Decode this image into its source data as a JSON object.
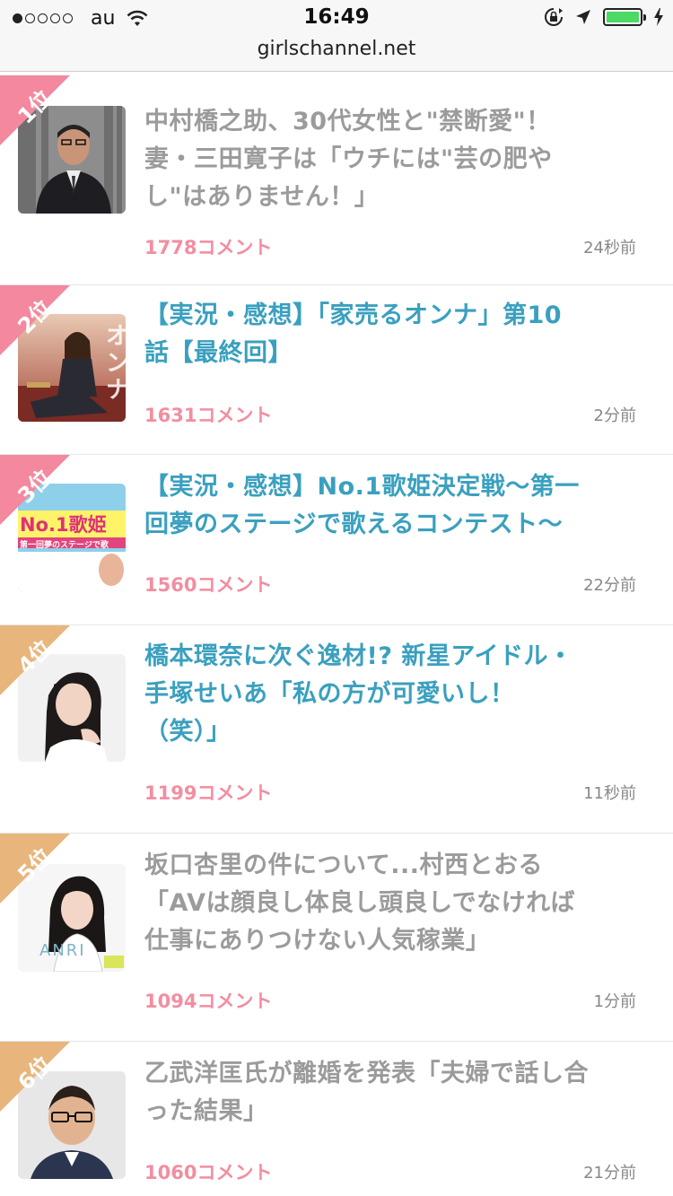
{
  "status_bar": {
    "carrier": "au",
    "time": "16:49",
    "url": "girlschannel.net",
    "signal_dots_filled": 1,
    "battery_level": 1.0
  },
  "colors": {
    "rank_pink": "#f4889e",
    "rank_gold": "#e8b67c",
    "comment_pink": "#f28ea0",
    "title_blue": "#3aa0bf",
    "title_gray": "#9b9b9b"
  },
  "ranking": [
    {
      "rank": "1位",
      "title": "中村橋之助、30代女性と\"禁断愛\"！\n妻・三田寛子は「ウチには\"芸の肥や\nし\"はありません！」",
      "comments": "1778コメント",
      "ago": "24秒前"
    },
    {
      "rank": "2位",
      "title": "【実況・感想】「家売るオンナ」第10\n話【最終回】",
      "comments": "1631コメント",
      "ago": "2分前"
    },
    {
      "rank": "3位",
      "title": "【実況・感想】No.1歌姫決定戦～第一\n回夢のステージで歌えるコンテスト～",
      "comments": "1560コメント",
      "ago": "22分前"
    },
    {
      "rank": "4位",
      "title": "橋本環奈に次ぐ逸材!? 新星アイドル・\n手塚せいあ「私の方が可愛いし！\n（笑）」",
      "comments": "1199コメント",
      "ago": "11秒前"
    },
    {
      "rank": "5位",
      "title": "坂口杏里の件について...村西とおる\n「AVは顔良し体良し頭良しでなければ\n仕事にありつけない人気稼業」",
      "comments": "1094コメント",
      "ago": "1分前"
    },
    {
      "rank": "6位",
      "title": "乙武洋匡氏が離婚を発表「夫婦で話し合\nった結果」",
      "comments": "1060コメント",
      "ago": "21分前"
    }
  ],
  "thumb_texts": {
    "t2": "オンナ",
    "t3_big": "No.1歌姫",
    "t3_sub": "第一回夢のステージで歌",
    "t5": "ANRI"
  }
}
